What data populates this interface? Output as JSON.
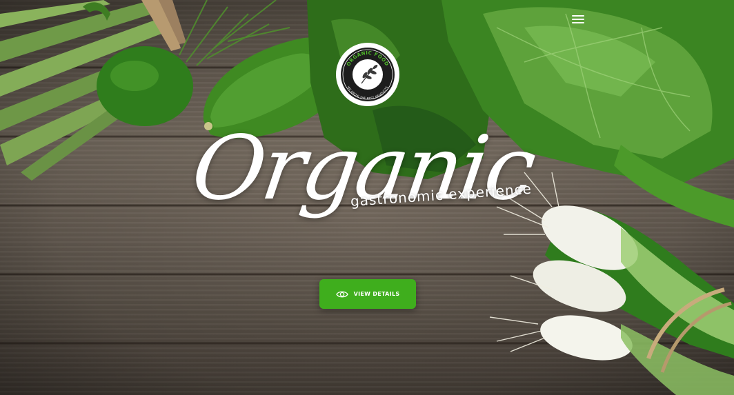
{
  "header": {
    "menu_icon": "hamburger-menu-icon"
  },
  "logo": {
    "ring_text_top": "ORGANIC FOOD",
    "ring_text_bottom": "WE GROW THE BEST PRODUCTS",
    "icon": "leaf-branch-icon"
  },
  "hero": {
    "title": "Organic",
    "subtitle": "gastronomic experience"
  },
  "cta": {
    "label": "VIEW DETAILS",
    "icon": "eye-icon",
    "color": "#3fae1d"
  },
  "colors": {
    "text": "#ffffff",
    "accent": "#3fae1d",
    "wood": "#6f655a"
  }
}
